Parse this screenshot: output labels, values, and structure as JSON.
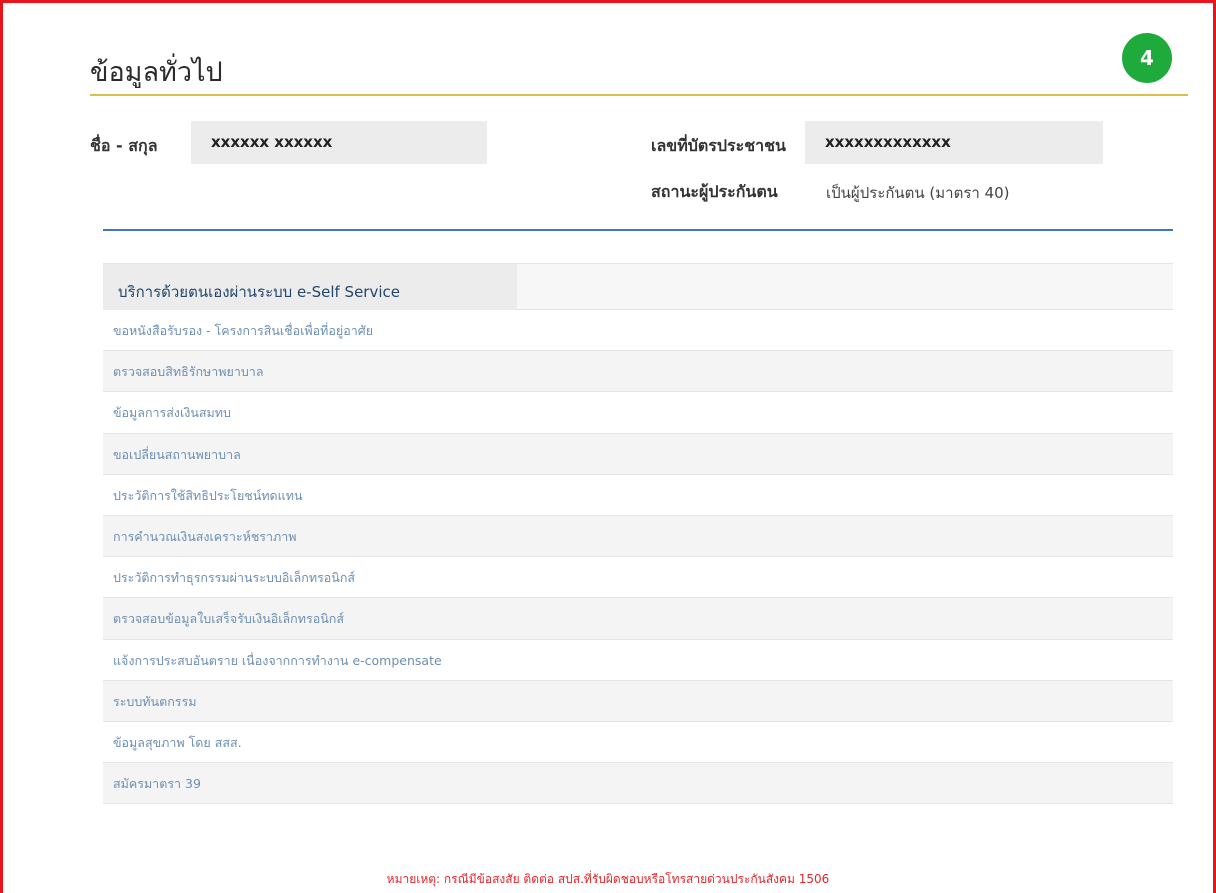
{
  "page": {
    "title": "ข้อมูลทั่วไป",
    "step_badge": "4"
  },
  "profile": {
    "name_label": "ชื่อ - สกุล",
    "name_value": "xxxxxx xxxxxx",
    "id_label": "เลขที่บัตรประชาชน",
    "id_value": "xxxxxxxxxxxxx",
    "status_label": "สถานะผู้ประกันตน",
    "status_value": "เป็นผู้ประกันตน (มาตรา 40)"
  },
  "services": {
    "header": "บริการด้วยตนเองผ่านระบบ e-Self Service",
    "items": [
      "ขอหนังสือรับรอง - โครงการสินเชื่อเพื่อที่อยู่อาศัย",
      "ตรวจสอบสิทธิรักษาพยาบาล",
      "ข้อมูลการส่งเงินสมทบ",
      "ขอเปลี่ยนสถานพยาบาล",
      "ประวัติการใช้สิทธิประโยชน์ทดแทน",
      "การคำนวณเงินสงเคราะห์ชราภาพ",
      "ประวัติการทำธุรกรรมผ่านระบบอิเล็กทรอนิกส์",
      "ตรวจสอบข้อมูลใบเสร็จรับเงินอิเล็กทรอนิกส์",
      "แจ้งการประสบอันตราย เนื่องจากการทำงาน e-compensate",
      "ระบบทันตกรรม",
      "ข้อมูลสุขภาพ โดย สสส.",
      "สมัครมาตรา 39"
    ]
  },
  "footer": {
    "note": "หมายเหตุ: กรณีมีข้อสงสัย ติดต่อ สปส.ที่รับผิดชอบหรือโทรสายด่วนประกันสังคม 1506"
  },
  "colors": {
    "frame_border": "#e8131b",
    "badge": "#1fab3c",
    "title_rule": "#dcbf4a",
    "section_rule": "#3b79b8",
    "link": "#6d8fb1",
    "note": "#e3262b"
  }
}
